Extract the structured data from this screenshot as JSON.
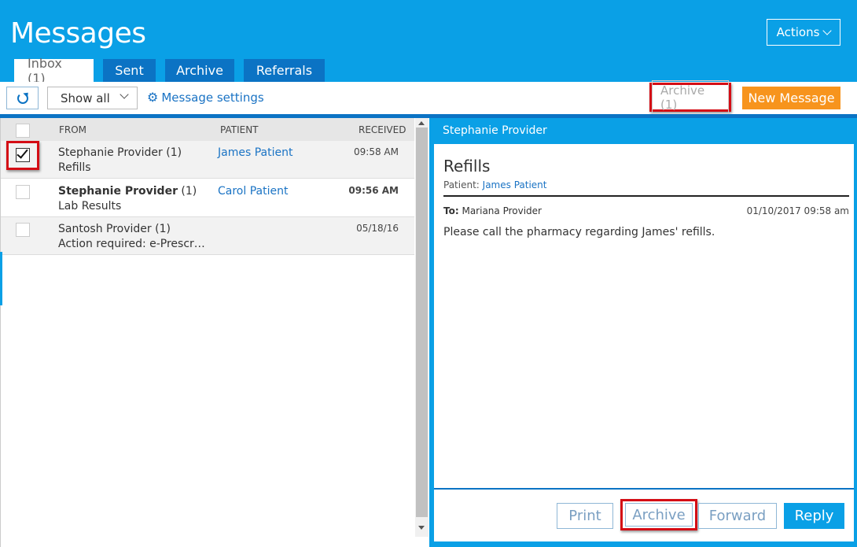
{
  "app": {
    "title": "Messages",
    "actions_label": "Actions"
  },
  "tabs": [
    {
      "label": "Inbox (1)",
      "active": true
    },
    {
      "label": "Sent",
      "active": false
    },
    {
      "label": "Archive",
      "active": false
    },
    {
      "label": "Referrals",
      "active": false
    }
  ],
  "toolbar": {
    "filter_value": "Show all",
    "settings_label": "Message settings",
    "archive_count_label": "Archive (1)",
    "new_message_label": "New Message"
  },
  "list": {
    "columns": {
      "from": "FROM",
      "patient": "PATIENT",
      "received": "RECEIVED"
    },
    "rows": [
      {
        "from": "Stephanie Provider",
        "count": " (1)",
        "subject": "Refills",
        "patient": "James Patient",
        "received": "09:58 AM",
        "checked": true,
        "unread": false
      },
      {
        "from": "Stephanie Provider",
        "count": " (1)",
        "subject": "Lab Results",
        "patient": "Carol Patient",
        "received": "09:56 AM",
        "checked": false,
        "unread": true
      },
      {
        "from": "Santosh Provider",
        "count": " (1)",
        "subject": "Action required: e-Prescr…",
        "patient": "",
        "received": "05/18/16",
        "checked": false,
        "unread": false
      }
    ]
  },
  "detail": {
    "sender": "Stephanie Provider",
    "subject": "Refills",
    "patient_label": "Patient:",
    "patient_name": "James Patient",
    "to_label": "To:",
    "to_name": "Mariana Provider",
    "date": "01/10/2017 09:58 am",
    "body": "Please call the pharmacy regarding James' refills.",
    "buttons": {
      "print": "Print",
      "archive": "Archive",
      "forward": "Forward",
      "reply": "Reply"
    }
  },
  "colors": {
    "brand_blue": "#0aa0e6",
    "dark_blue": "#0b73c4",
    "orange": "#f7941d",
    "highlight_red": "#d40d15"
  },
  "icons": {
    "refresh": "refresh-icon",
    "settings": "gear-icon",
    "dropdown": "chevron-down-icon"
  }
}
